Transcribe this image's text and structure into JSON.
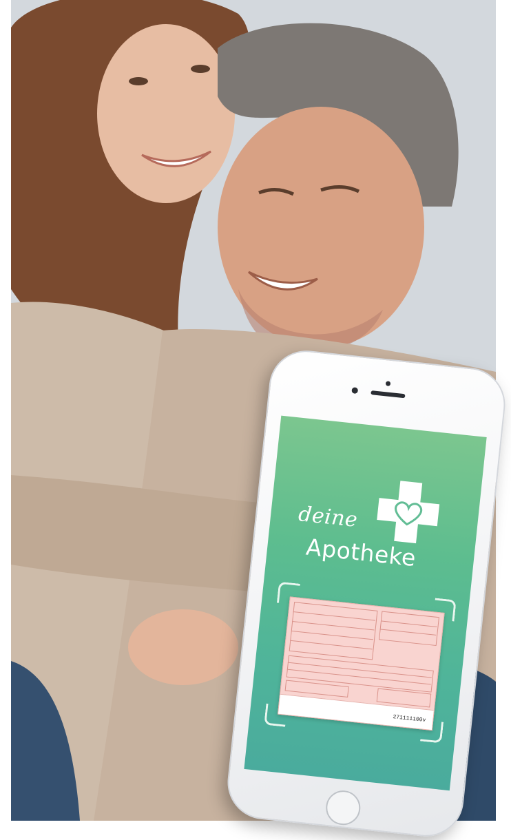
{
  "photo": {
    "subject": "smiling-couple-photo"
  },
  "phone": {
    "brand_logo": {
      "word_top": "deine",
      "word_bottom": "Apotheke",
      "icon": "cross-heart-icon"
    },
    "prescription": {
      "form_number": "271111100v"
    }
  },
  "colors": {
    "screen_top": "#7cc68f",
    "screen_bottom": "#4aab9d",
    "prescription_pink": "#f9d4d0",
    "logo_white": "#ffffff"
  }
}
